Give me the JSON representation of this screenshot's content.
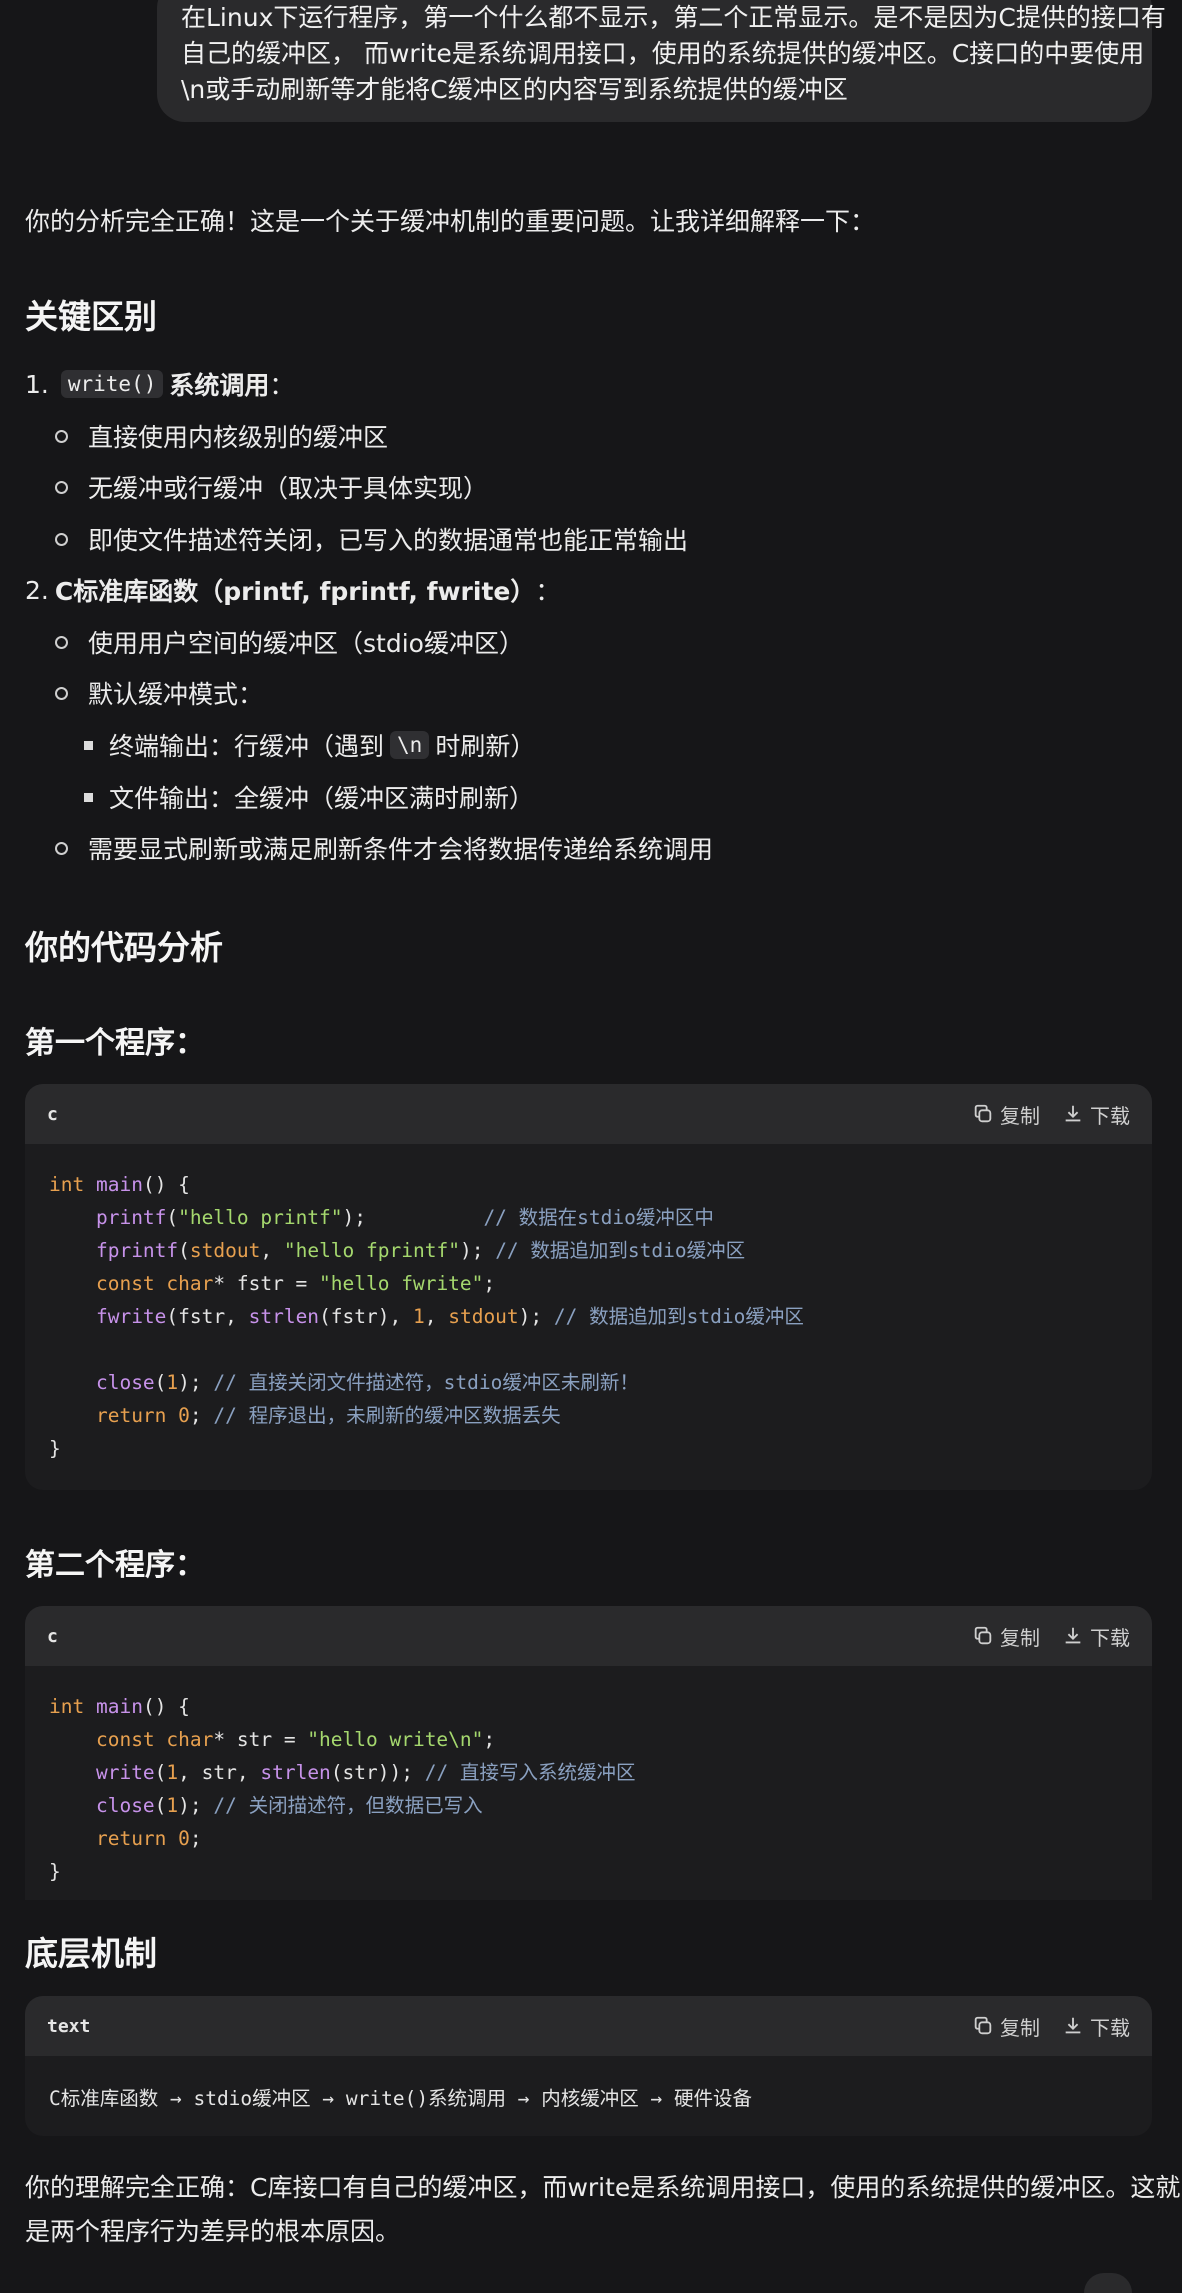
{
  "user_message": {
    "lines": [
      "在Linux下运行程序，第一个什么都不显示，第二个正常显示。是不是因为C提供的接口有",
      "自己的缓冲区，  而write是系统调用接口，使用的系统提供的缓冲区。C接口的中要使用",
      "\\n或手动刷新等才能将C缓冲区的内容写到系统提供的缓冲区"
    ]
  },
  "intro": "你的分析完全正确！这是一个关于缓冲机制的重要问题。让我详细解释一下：",
  "section_key_diff": {
    "title": "关键区别",
    "item1": {
      "num": "1.",
      "code": "write()",
      "label": "系统调用",
      "suffix": "：",
      "subs": [
        "直接使用内核级别的缓冲区",
        "无缓冲或行缓冲（取决于具体实现）",
        "即使文件描述符关闭，已写入的数据通常也能正常输出"
      ]
    },
    "item2": {
      "num": "2.",
      "label": "C标准库函数（printf, fprintf, fwrite）",
      "suffix": "：",
      "sub1": "使用用户空间的缓冲区（stdio缓冲区）",
      "sub2": "默认缓冲模式：",
      "sub2_items": {
        "a_pre": "终端输出：行缓冲（遇到",
        "a_code": "\\n",
        "a_post": "时刷新）",
        "b": "文件输出：全缓冲（缓冲区满时刷新）"
      },
      "sub3": "需要显式刷新或满足刷新条件才会将数据传递给系统调用"
    }
  },
  "section_code": {
    "title": "你的代码分析"
  },
  "program1": {
    "title": "第一个程序：",
    "lang": "c"
  },
  "program2": {
    "title": "第二个程序：",
    "lang": "c"
  },
  "section_mech": {
    "title": "底层机制"
  },
  "mech_block": {
    "lang": "text",
    "content": "C标准库函数 → stdio缓冲区 → write()系统调用 → 内核缓冲区 → 硬件设备"
  },
  "actions": {
    "copy": "复制",
    "download": "下载"
  },
  "conclusion": {
    "line1": "你的理解完全正确：C库接口有自己的缓冲区，而write是系统调用接口，使用的系统提供的缓冲区。这就",
    "line2": "是两个程序行为差异的根本原因。"
  },
  "code1": [
    [
      [
        "kw",
        "int"
      ],
      [
        "p",
        " "
      ],
      [
        "fn",
        "main"
      ],
      [
        "p",
        "() {"
      ]
    ],
    [
      [
        "p",
        "    "
      ],
      [
        "fn",
        "printf"
      ],
      [
        "p",
        "("
      ],
      [
        "str",
        "\"hello printf\""
      ],
      [
        "p",
        ");          "
      ],
      [
        "com",
        "// 数据在stdio缓冲区中"
      ]
    ],
    [
      [
        "p",
        "    "
      ],
      [
        "fn",
        "fprintf"
      ],
      [
        "p",
        "("
      ],
      [
        "kw",
        "stdout"
      ],
      [
        "p",
        ", "
      ],
      [
        "str",
        "\"hello fprintf\""
      ],
      [
        "p",
        "); "
      ],
      [
        "com",
        "// 数据追加到stdio缓冲区"
      ]
    ],
    [
      [
        "p",
        "    "
      ],
      [
        "kw",
        "const char"
      ],
      [
        "p",
        "* fstr = "
      ],
      [
        "str",
        "\"hello fwrite\""
      ],
      [
        "p",
        ";"
      ]
    ],
    [
      [
        "p",
        "    "
      ],
      [
        "fn",
        "fwrite"
      ],
      [
        "p",
        "(fstr, "
      ],
      [
        "fn",
        "strlen"
      ],
      [
        "p",
        "(fstr), "
      ],
      [
        "num",
        "1"
      ],
      [
        "p",
        ", "
      ],
      [
        "kw",
        "stdout"
      ],
      [
        "p",
        "); "
      ],
      [
        "com",
        "// 数据追加到stdio缓冲区"
      ]
    ],
    [
      [
        "p",
        ""
      ]
    ],
    [
      [
        "p",
        "    "
      ],
      [
        "fn",
        "close"
      ],
      [
        "p",
        "("
      ],
      [
        "num",
        "1"
      ],
      [
        "p",
        "); "
      ],
      [
        "com",
        "// 直接关闭文件描述符，stdio缓冲区未刷新！"
      ]
    ],
    [
      [
        "p",
        "    "
      ],
      [
        "kw",
        "return"
      ],
      [
        "p",
        " "
      ],
      [
        "num",
        "0"
      ],
      [
        "p",
        "; "
      ],
      [
        "com",
        "// 程序退出，未刷新的缓冲区数据丢失"
      ]
    ],
    [
      [
        "p",
        "}"
      ]
    ]
  ],
  "code2": [
    [
      [
        "kw",
        "int"
      ],
      [
        "p",
        " "
      ],
      [
        "fn",
        "main"
      ],
      [
        "p",
        "() {"
      ]
    ],
    [
      [
        "p",
        "    "
      ],
      [
        "kw",
        "const char"
      ],
      [
        "p",
        "* str = "
      ],
      [
        "str",
        "\"hello write\\n\""
      ],
      [
        "p",
        ";"
      ]
    ],
    [
      [
        "p",
        "    "
      ],
      [
        "fn",
        "write"
      ],
      [
        "p",
        "("
      ],
      [
        "num",
        "1"
      ],
      [
        "p",
        ", str, "
      ],
      [
        "fn",
        "strlen"
      ],
      [
        "p",
        "(str)); "
      ],
      [
        "com",
        "// 直接写入系统缓冲区"
      ]
    ],
    [
      [
        "p",
        "    "
      ],
      [
        "fn",
        "close"
      ],
      [
        "p",
        "("
      ],
      [
        "num",
        "1"
      ],
      [
        "p",
        "); "
      ],
      [
        "com",
        "// 关闭描述符，但数据已写入"
      ]
    ],
    [
      [
        "p",
        "    "
      ],
      [
        "kw",
        "return"
      ],
      [
        "p",
        " "
      ],
      [
        "num",
        "0"
      ],
      [
        "p",
        ";"
      ]
    ],
    [
      [
        "p",
        "}"
      ]
    ]
  ]
}
